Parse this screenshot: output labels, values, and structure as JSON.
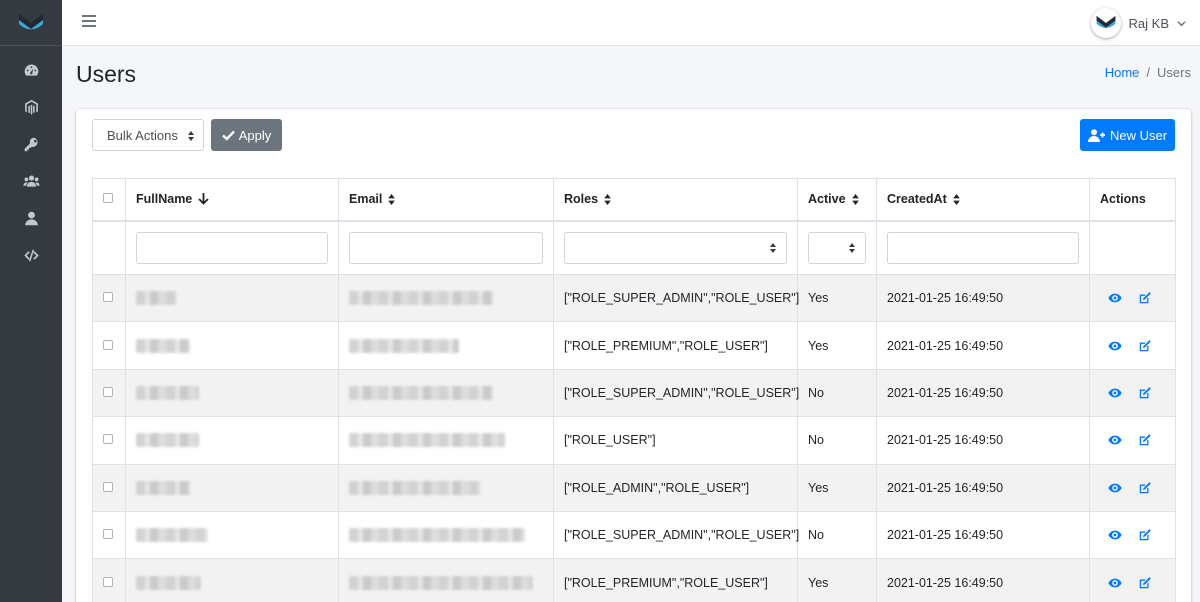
{
  "app": {
    "user_name": "Raj KB"
  },
  "header": {
    "title": "Users"
  },
  "breadcrumb": {
    "home": "Home",
    "separator": "/",
    "current": "Users"
  },
  "sidebar": {
    "items": [
      {
        "icon": "tachometer-icon"
      },
      {
        "icon": "magento-icon"
      },
      {
        "icon": "key-icon"
      },
      {
        "icon": "users-icon"
      },
      {
        "icon": "user-icon"
      },
      {
        "icon": "code-icon"
      }
    ]
  },
  "toolbar": {
    "bulk_actions_label": "Bulk Actions",
    "apply_label": "Apply",
    "new_user_label": "New User"
  },
  "table": {
    "columns": {
      "fullname": "FullName",
      "email": "Email",
      "roles": "Roles",
      "active": "Active",
      "created_at": "CreatedAt",
      "actions": "Actions"
    },
    "rows": [
      {
        "name_blur": 0.45,
        "email_blur": 0.72,
        "roles": "[\"ROLE_SUPER_ADMIN\",\"ROLE_USER\"]",
        "active": "Yes",
        "created_at": "2021-01-25 16:49:50"
      },
      {
        "name_blur": 0.6,
        "email_blur": 0.55,
        "roles": "[\"ROLE_PREMIUM\",\"ROLE_USER\"]",
        "active": "Yes",
        "created_at": "2021-01-25 16:49:50"
      },
      {
        "name_blur": 0.7,
        "email_blur": 0.72,
        "roles": "[\"ROLE_SUPER_ADMIN\",\"ROLE_USER\"]",
        "active": "No",
        "created_at": "2021-01-25 16:49:50"
      },
      {
        "name_blur": 0.7,
        "email_blur": 0.78,
        "roles": "[\"ROLE_USER\"]",
        "active": "No",
        "created_at": "2021-01-25 16:49:50"
      },
      {
        "name_blur": 0.6,
        "email_blur": 0.66,
        "roles": "[\"ROLE_ADMIN\",\"ROLE_USER\"]",
        "active": "Yes",
        "created_at": "2021-01-25 16:49:50"
      },
      {
        "name_blur": 0.8,
        "email_blur": 0.88,
        "roles": "[\"ROLE_SUPER_ADMIN\",\"ROLE_USER\"]",
        "active": "No",
        "created_at": "2021-01-25 16:49:50"
      },
      {
        "name_blur": 0.72,
        "email_blur": 0.92,
        "roles": "[\"ROLE_PREMIUM\",\"ROLE_USER\"]",
        "active": "Yes",
        "created_at": "2021-01-25 16:49:50"
      }
    ]
  },
  "colors": {
    "sidebar": "#343a40",
    "primary": "#007bff",
    "secondary": "#6c757d",
    "row_stripe": "#f2f2f2"
  }
}
